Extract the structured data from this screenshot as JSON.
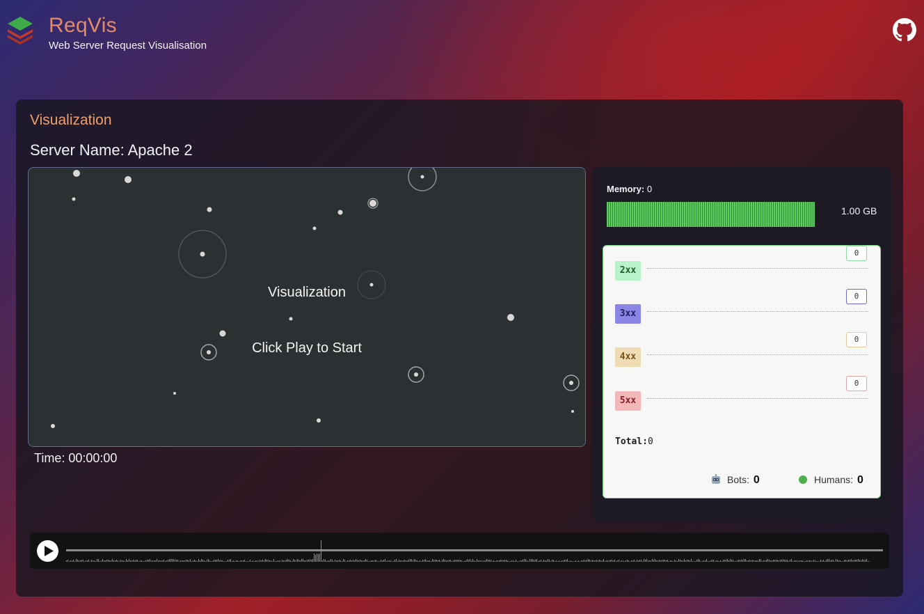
{
  "header": {
    "brand_title": "ReqVis",
    "brand_subtitle": "Web Server Request Visualisation",
    "logo_icon": "layers-icon",
    "github_icon": "github-icon"
  },
  "panel": {
    "title": "Visualization",
    "server_name": "Server Name: Apache 2"
  },
  "visualization": {
    "title_text": "Visualization",
    "prompt_text": "Click Play to Start",
    "time_text": "Time: 00:00:00"
  },
  "memory": {
    "label": "Memory:",
    "value": "0",
    "capacity": "1.00 GB"
  },
  "status_codes": {
    "rows": [
      {
        "code": "2xx",
        "count": "0",
        "bg": "#b8f2c8",
        "fg": "#1f5e30",
        "border": "#8fdca3"
      },
      {
        "code": "3xx",
        "count": "0",
        "bg": "#8a86e6",
        "fg": "#20205a",
        "border": "#6c6ad0"
      },
      {
        "code": "4xx",
        "count": "0",
        "bg": "#f0dcb4",
        "fg": "#7a5218",
        "border": "#e8c99a"
      },
      {
        "code": "5xx",
        "count": "0",
        "bg": "#f2b8ba",
        "fg": "#8a1f24",
        "border": "#e5a2a4"
      }
    ],
    "total_label": "Total:",
    "total_value": "0"
  },
  "visitors": {
    "bots_label": "Bots:",
    "bots_value": "0",
    "humans_label": "Humans:",
    "humans_value": "0"
  },
  "player": {
    "play_icon": "play-icon"
  },
  "colors": {
    "accent_orange": "#f0a06a",
    "brand": "#e38a6a",
    "memory_green": "#5ecf5e",
    "timeline_green": "#4cbf4c"
  }
}
